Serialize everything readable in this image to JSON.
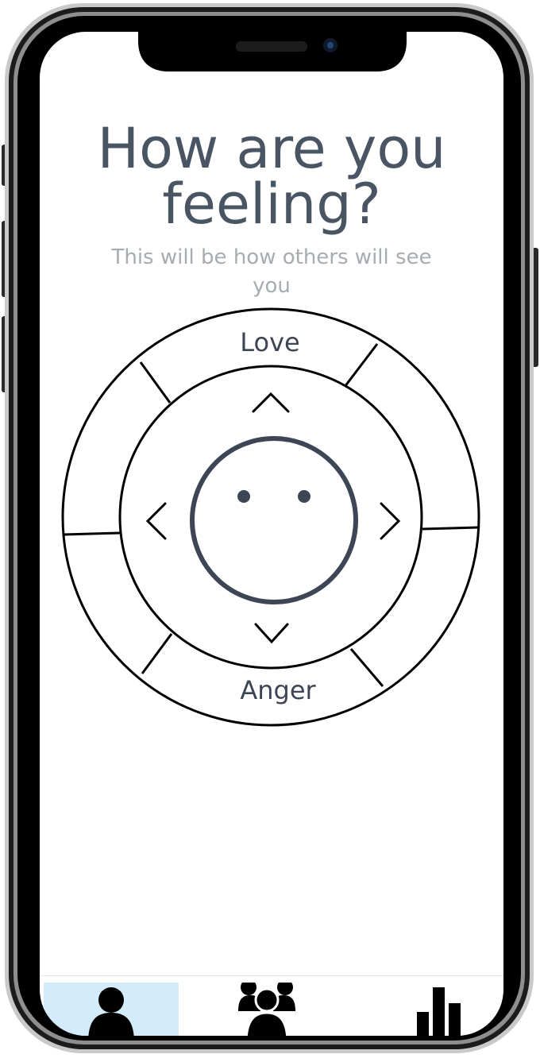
{
  "screen": {
    "title_line1": "How are you",
    "title_line2": "feeling?",
    "subtitle_line1": "This will be how others will see",
    "subtitle_line2": "you"
  },
  "mood_wheel": {
    "top_label": "Love",
    "bottom_label": "Anger"
  },
  "tab_bar": {
    "tabs": [
      {
        "name": "profile",
        "icon": "person-icon",
        "active": true
      },
      {
        "name": "friends",
        "icon": "group-icon",
        "active": false
      },
      {
        "name": "stats",
        "icon": "bar-chart-icon",
        "active": false
      }
    ],
    "active_color": "#d3ebfa"
  },
  "colors": {
    "title": "#4a5563",
    "subtitle": "#a7acb2",
    "face": "#3d4654"
  }
}
